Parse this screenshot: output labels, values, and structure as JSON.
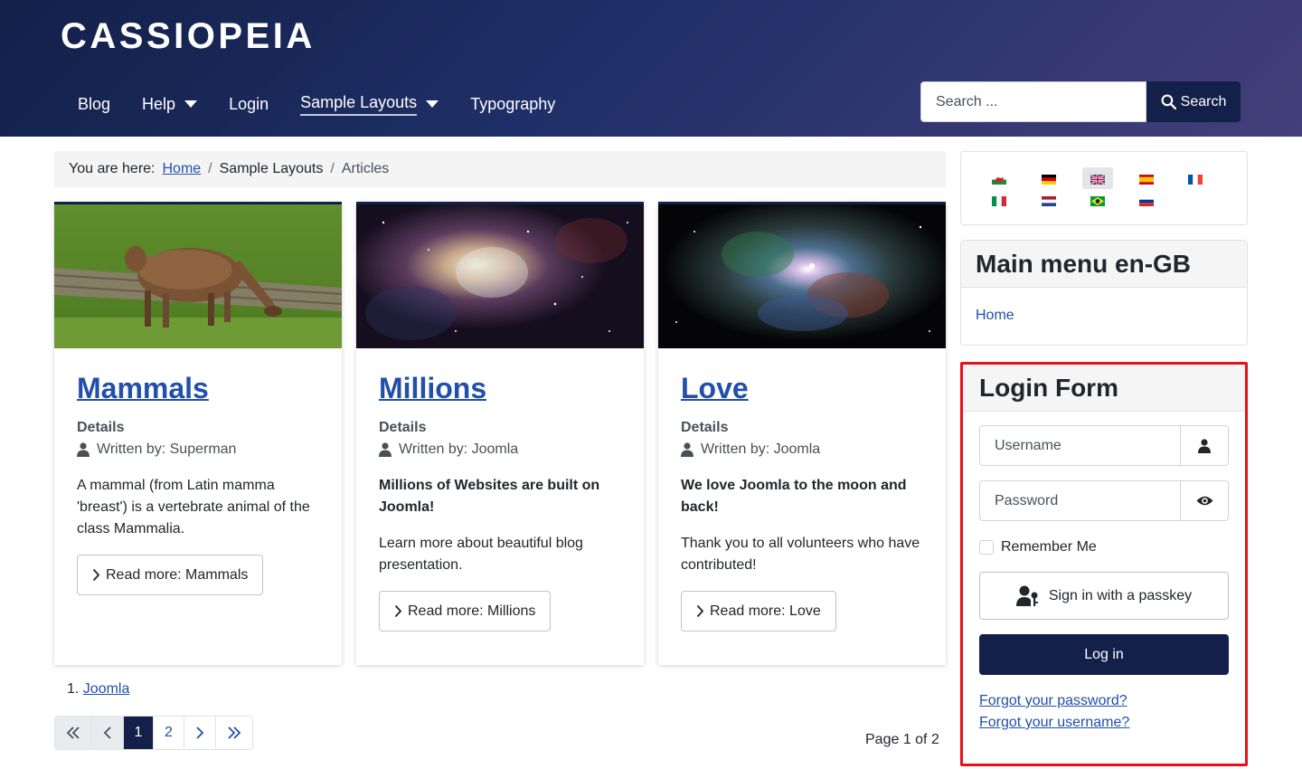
{
  "site": {
    "brand": "CASSIOPEIA"
  },
  "nav": {
    "items": [
      {
        "label": "Blog",
        "dropdown": false,
        "active": false
      },
      {
        "label": "Help",
        "dropdown": true,
        "active": false
      },
      {
        "label": "Login",
        "dropdown": false,
        "active": false
      },
      {
        "label": "Sample Layouts",
        "dropdown": true,
        "active": true
      },
      {
        "label": "Typography",
        "dropdown": false,
        "active": false
      }
    ]
  },
  "search": {
    "placeholder": "Search ...",
    "button_label": "Search"
  },
  "breadcrumb": {
    "prefix": "You are here:",
    "items": [
      "Home",
      "Sample Layouts",
      "Articles"
    ]
  },
  "cards": [
    {
      "title": "Mammals",
      "image": "llama-photo",
      "details_label": "Details",
      "author": "Written by: Superman",
      "intro_bold": "",
      "intro": "A mammal (from Latin mamma 'breast') is a vertebrate animal of the class Mammalia.",
      "read_more": "Read more: Mammals"
    },
    {
      "title": "Millions",
      "image": "galaxy-photo",
      "details_label": "Details",
      "author": "Written by: Joomla",
      "intro_bold": "Millions of Websites are built on Joomla!",
      "intro": "Learn more about beautiful blog presentation.",
      "read_more": "Read more: Millions"
    },
    {
      "title": "Love",
      "image": "nebula-photo",
      "details_label": "Details",
      "author": "Written by: Joomla",
      "intro_bold": "We love Joomla to the moon and back!",
      "intro": "Thank you to all volunteers who have contributed!",
      "read_more": "Read more: Love"
    }
  ],
  "more_list": {
    "number": "1.",
    "link": "Joomla"
  },
  "pagination": {
    "pages": [
      "1",
      "2"
    ],
    "current": "1",
    "counter": "Page 1 of 2",
    "first_icon": "double-chevron-left-icon",
    "prev_icon": "chevron-left-icon",
    "next_icon": "chevron-right-icon",
    "last_icon": "double-chevron-right-icon"
  },
  "languages": {
    "flags": [
      "wales",
      "germany",
      "uk",
      "spain",
      "france",
      "italy",
      "netherlands",
      "brazil",
      "russia"
    ],
    "selected": "uk"
  },
  "main_menu": {
    "title": "Main menu en-GB",
    "items": [
      "Home"
    ]
  },
  "login_form": {
    "title": "Login Form",
    "username_placeholder": "Username",
    "password_placeholder": "Password",
    "remember_label": "Remember Me",
    "passkey_label": "Sign in with a passkey",
    "login_label": "Log in",
    "forgot_password": "Forgot your password?",
    "forgot_username": "Forgot your username?"
  },
  "colors": {
    "header_dark": "#132049",
    "link": "#224faa",
    "highlight_border": "#e8101a"
  }
}
